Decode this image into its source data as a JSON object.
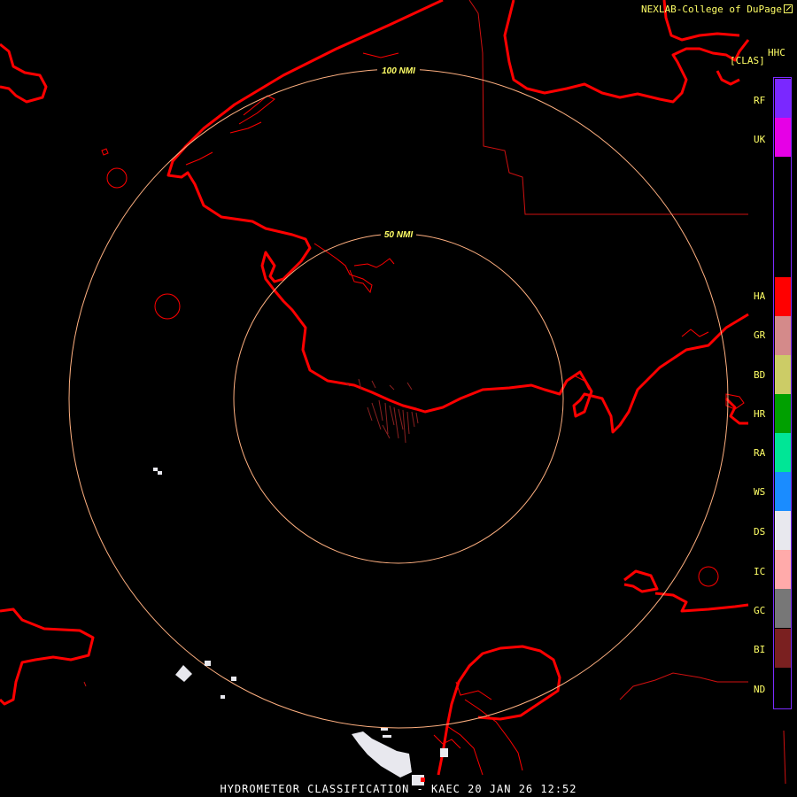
{
  "header": {
    "credit": "NEXLAB-College of DuPage",
    "product_code": "HHC",
    "product_tag": "[CLAS]"
  },
  "footer": {
    "title": "HYDROMETEOR CLASSIFICATION - KAEC 20 JAN 26 12:52"
  },
  "range_rings": [
    {
      "label": "100 NMI",
      "range_nmi": 100
    },
    {
      "label": "50 NMI",
      "range_nmi": 50
    }
  ],
  "legend": [
    {
      "code": "RF",
      "color": "#7a28ff"
    },
    {
      "code": "UK",
      "color": "#e600e6"
    },
    {
      "code": "HA",
      "color": "#ff0000"
    },
    {
      "code": "GR",
      "color": "#d48a8a"
    },
    {
      "code": "BD",
      "color": "#cccc66"
    },
    {
      "code": "HR",
      "color": "#00a000"
    },
    {
      "code": "RA",
      "color": "#00e696"
    },
    {
      "code": "WS",
      "color": "#1a8cff"
    },
    {
      "code": "DS",
      "color": "#e8e8ee"
    },
    {
      "code": "IC",
      "color": "#ffaaaa"
    },
    {
      "code": "GC",
      "color": "#777777"
    },
    {
      "code": "BI",
      "color": "#7a2020"
    },
    {
      "code": "ND",
      "color": ""
    }
  ],
  "colors": {
    "coastline": "#ff0000",
    "border": "#d01010",
    "ring": "#ffb080",
    "ring_label": "#ffff66"
  }
}
